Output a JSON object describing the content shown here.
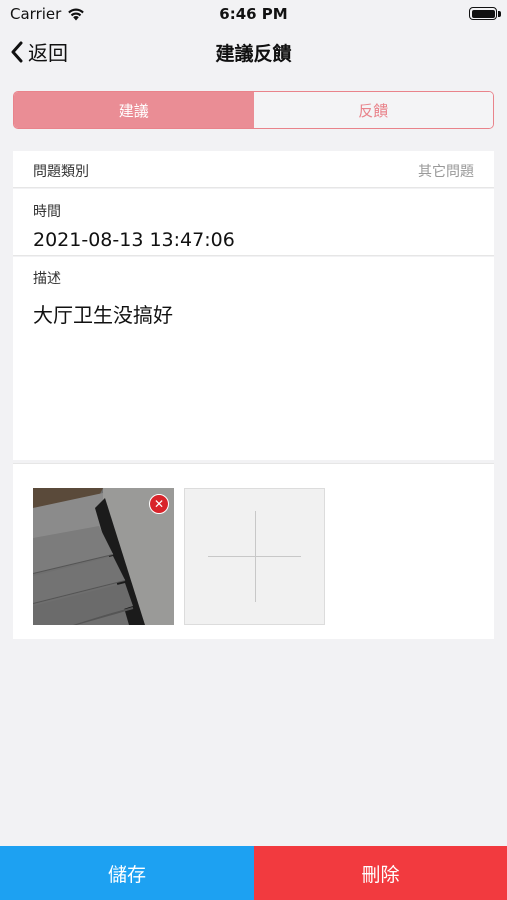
{
  "status_bar": {
    "carrier": "Carrier",
    "time": "6:46 PM"
  },
  "nav": {
    "back_label": "返回",
    "title": "建議反饋"
  },
  "tabs": [
    {
      "label": "建議",
      "active": true
    },
    {
      "label": "反饋",
      "active": false
    }
  ],
  "form": {
    "category": {
      "label": "問題類別",
      "value": "其它問題"
    },
    "time": {
      "label": "時間",
      "value": "2021-08-13 13:47:06"
    },
    "description": {
      "label": "描述",
      "value": "大厅卫生没搞好"
    }
  },
  "photos": {
    "count": 1,
    "remove_icon": "close-icon",
    "add_icon": "plus-icon"
  },
  "actions": {
    "save_label": "儲存",
    "delete_label": "刪除"
  },
  "colors": {
    "accent_pink": "#ea8d95",
    "save_blue": "#1da1f2",
    "delete_red": "#f23a3f",
    "background": "#f2f2f4"
  }
}
